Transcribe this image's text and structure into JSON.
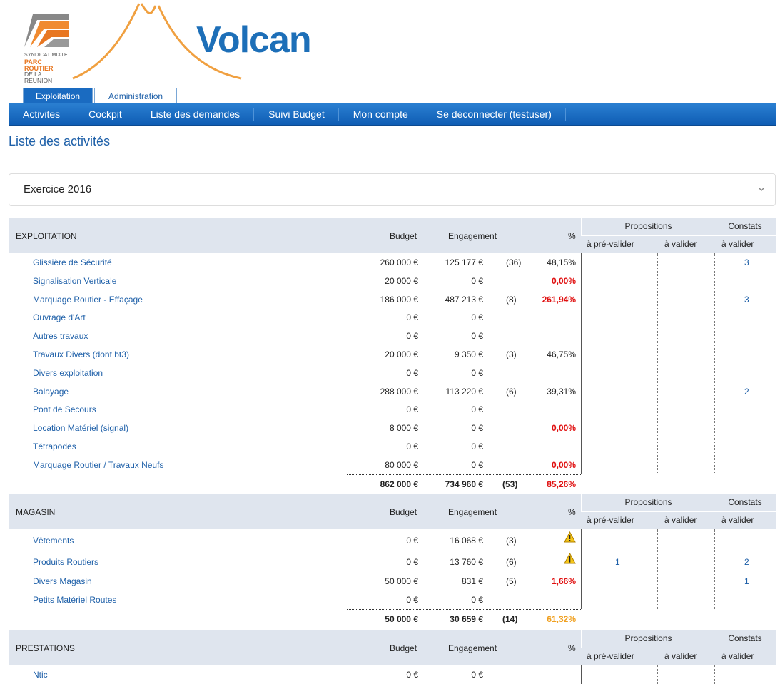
{
  "header": {
    "org_logo": {
      "line1": "SYNDICAT MIXTE",
      "line2a": "PARC ROUTIER",
      "line3": "DE LA RÉUNION"
    },
    "app_title": "Volcan",
    "brand_color": "#1d6fb8",
    "accent_color": "#e87722"
  },
  "tabs": [
    {
      "label": "Exploitation",
      "active": true
    },
    {
      "label": "Administration",
      "active": false
    }
  ],
  "nav": [
    "Activites",
    "Cockpit",
    "Liste des demandes",
    "Suivi Budget",
    "Mon compte",
    "Se déconnecter (testuser)"
  ],
  "page_title": "Liste des activités",
  "exercise_select": {
    "value": "Exercice 2016"
  },
  "column_labels": {
    "budget": "Budget",
    "engagement": "Engagement",
    "pct": "%",
    "propositions": "Propositions",
    "constats": "Constats",
    "pre_valider": "à pré-valider",
    "a_valider": "à valider",
    "c_valider": "à valider"
  },
  "sections": [
    {
      "name": "EXPLOITATION",
      "rows": [
        {
          "name": "Glissière de Sécurité",
          "budget": "260 000 €",
          "engagement": "125 177 €",
          "count": "(36)",
          "pct": "48,15%",
          "pct_style": "",
          "prop_pre": "",
          "constats": "3"
        },
        {
          "name": "Signalisation Verticale",
          "budget": "20 000 €",
          "engagement": "0 €",
          "count": "",
          "pct": "0,00%",
          "pct_style": "red",
          "prop_pre": "",
          "constats": ""
        },
        {
          "name": "Marquage Routier - Effaçage",
          "budget": "186 000 €",
          "engagement": "487 213 €",
          "count": "(8)",
          "pct": "261,94%",
          "pct_style": "red",
          "prop_pre": "",
          "constats": "3"
        },
        {
          "name": "Ouvrage d'Art",
          "budget": "0 €",
          "engagement": "0 €",
          "count": "",
          "pct": "",
          "pct_style": "",
          "prop_pre": "",
          "constats": ""
        },
        {
          "name": "Autres travaux",
          "budget": "0 €",
          "engagement": "0 €",
          "count": "",
          "pct": "",
          "pct_style": "",
          "prop_pre": "",
          "constats": ""
        },
        {
          "name": "Travaux Divers (dont bt3)",
          "budget": "20 000 €",
          "engagement": "9 350 €",
          "count": "(3)",
          "pct": "46,75%",
          "pct_style": "",
          "prop_pre": "",
          "constats": ""
        },
        {
          "name": "Divers exploitation",
          "budget": "0 €",
          "engagement": "0 €",
          "count": "",
          "pct": "",
          "pct_style": "",
          "prop_pre": "",
          "constats": ""
        },
        {
          "name": "Balayage",
          "budget": "288 000 €",
          "engagement": "113 220 €",
          "count": "(6)",
          "pct": "39,31%",
          "pct_style": "",
          "prop_pre": "",
          "constats": "2"
        },
        {
          "name": "Pont de Secours",
          "budget": "0 €",
          "engagement": "0 €",
          "count": "",
          "pct": "",
          "pct_style": "",
          "prop_pre": "",
          "constats": ""
        },
        {
          "name": "Location Matériel (signal)",
          "budget": "8 000 €",
          "engagement": "0 €",
          "count": "",
          "pct": "0,00%",
          "pct_style": "red",
          "prop_pre": "",
          "constats": ""
        },
        {
          "name": "Tétrapodes",
          "budget": "0 €",
          "engagement": "0 €",
          "count": "",
          "pct": "",
          "pct_style": "",
          "prop_pre": "",
          "constats": ""
        },
        {
          "name": "Marquage Routier / Travaux Neufs",
          "budget": "80 000 €",
          "engagement": "0 €",
          "count": "",
          "pct": "0,00%",
          "pct_style": "red",
          "prop_pre": "",
          "constats": ""
        }
      ],
      "total": {
        "budget": "862 000 €",
        "engagement": "734 960 €",
        "count": "(53)",
        "pct": "85,26%",
        "pct_style": "red"
      }
    },
    {
      "name": "MAGASIN",
      "rows": [
        {
          "name": "Vêtements",
          "budget": "0 €",
          "engagement": "16 068 €",
          "count": "(3)",
          "pct": "",
          "warning": true,
          "pct_style": "",
          "prop_pre": "",
          "constats": ""
        },
        {
          "name": "Produits Routiers",
          "budget": "0 €",
          "engagement": "13 760 €",
          "count": "(6)",
          "pct": "",
          "warning": true,
          "pct_style": "",
          "prop_pre": "1",
          "constats": "2"
        },
        {
          "name": "Divers Magasin",
          "budget": "50 000 €",
          "engagement": "831 €",
          "count": "(5)",
          "pct": "1,66%",
          "pct_style": "red",
          "prop_pre": "",
          "constats": "1"
        },
        {
          "name": "Petits Matériel Routes",
          "budget": "0 €",
          "engagement": "0 €",
          "count": "",
          "pct": "",
          "pct_style": "",
          "prop_pre": "",
          "constats": ""
        }
      ],
      "total": {
        "budget": "50 000 €",
        "engagement": "30 659 €",
        "count": "(14)",
        "pct": "61,32%",
        "pct_style": "orange"
      }
    },
    {
      "name": "PRESTATIONS",
      "rows": [
        {
          "name": "Ntic",
          "budget": "0 €",
          "engagement": "0 €",
          "count": "",
          "pct": "",
          "pct_style": "",
          "prop_pre": "",
          "constats": ""
        }
      ]
    }
  ]
}
